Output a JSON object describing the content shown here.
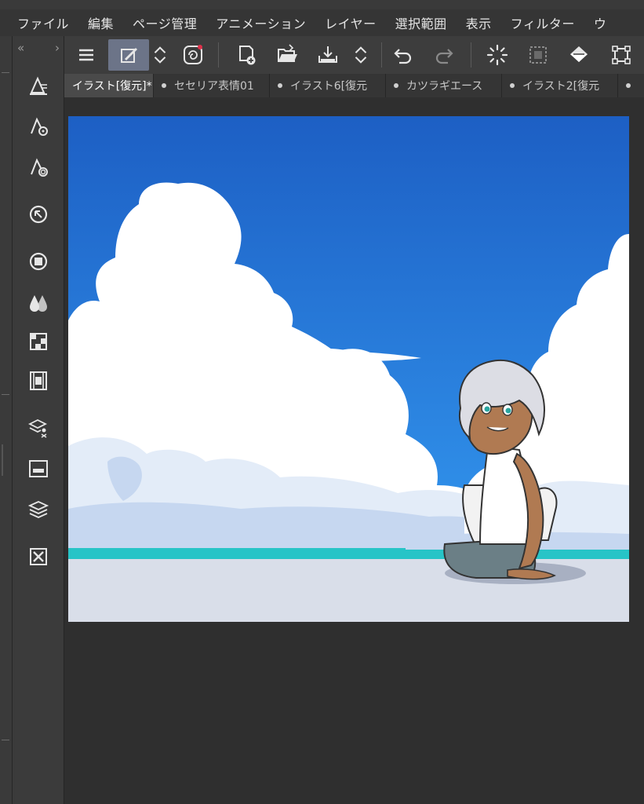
{
  "menubar": {
    "items": [
      "ファイル",
      "編集",
      "ページ管理",
      "アニメーション",
      "レイヤー",
      "選択範囲",
      "表示",
      "フィルター",
      "ウ"
    ]
  },
  "tool_palette": {
    "collapse_left": "«",
    "collapse_right": "›",
    "icons": [
      "pen-tool-icon",
      "tool-property-icon",
      "brush-size-icon",
      "navigator-icon",
      "sub-tool-icon",
      "color-mix-icon",
      "color-set-icon",
      "animation-timeline-icon",
      "material-icon",
      "layer-property-icon",
      "layer-icon",
      "close-panel-icon"
    ]
  },
  "command_bar": {
    "icons": [
      "menu-icon",
      "edit-canvas-icon",
      "scroll-updown-icon",
      "quick-access-icon",
      "new-file-icon",
      "open-file-icon",
      "save-icon",
      "scroll-updown-icon",
      "undo-icon",
      "redo-icon",
      "loading-icon",
      "selection-icon",
      "fill-icon",
      "transform-icon"
    ]
  },
  "tabs": [
    {
      "label": "イラスト[復元]*",
      "active": true
    },
    {
      "label": "セセリア表情01",
      "active": false
    },
    {
      "label": "イラスト6[復元",
      "active": false
    },
    {
      "label": "カツラギエース",
      "active": false
    },
    {
      "label": "イラスト2[復元",
      "active": false
    },
    {
      "label": "",
      "active": false
    }
  ],
  "colors": {
    "sky_top": "#1d5fc4",
    "sky_bottom": "#2f8ee8",
    "cloud": "#ffffff",
    "cloud_shadow": "#c6d7f0",
    "sea": "#27c4c7",
    "ground": "#d9dee9",
    "accent_active": "#6c7488"
  }
}
